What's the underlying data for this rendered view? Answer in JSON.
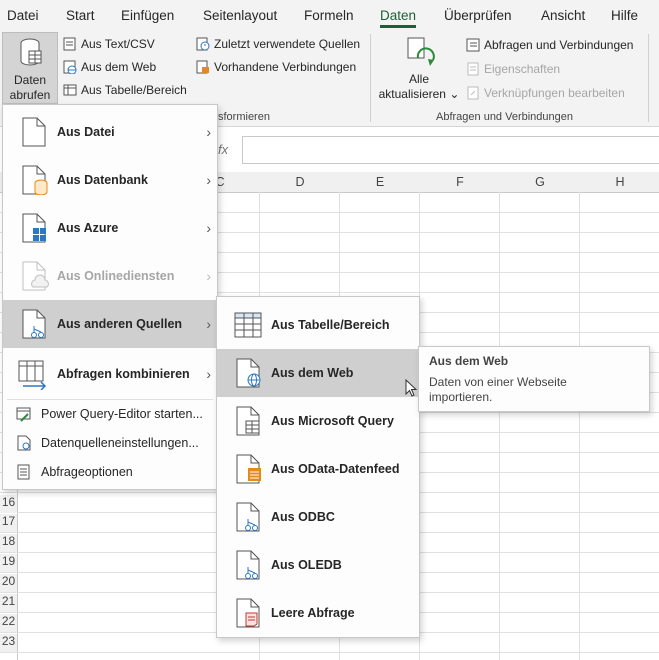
{
  "menubar": {
    "tabs": [
      "Datei",
      "Start",
      "Einfügen",
      "Seitenlayout",
      "Formeln",
      "Daten",
      "Überprüfen",
      "Ansicht",
      "Hilfe"
    ],
    "active": "Daten"
  },
  "ribbon": {
    "get_data": {
      "line1": "Daten",
      "line2": "abrufen ⌄"
    },
    "from_text": "Aus Text/CSV",
    "from_web": "Aus dem Web",
    "from_table": "Aus Tabelle/Bereich",
    "recent_sources": "Zuletzt verwendete Quellen",
    "existing_connections": "Vorhandene Verbindungen",
    "transform_group_label": "sformieren",
    "refresh_all": {
      "line1": "Alle",
      "line2": "aktualisieren ⌄"
    },
    "queries_connections": "Abfragen und Verbindungen",
    "properties": "Eigenschaften",
    "edit_links": "Verknüpfungen bearbeiten",
    "queries_group_label": "Abfragen und Verbindungen"
  },
  "formula_bar": {
    "fx": "fx"
  },
  "columns": [
    "C",
    "D",
    "E",
    "F",
    "G",
    "H"
  ],
  "rows": [
    "16",
    "17",
    "18",
    "19",
    "20",
    "21",
    "22",
    "23"
  ],
  "main_menu": {
    "items": [
      {
        "label": "Aus Datei",
        "icon": "file-icon",
        "submenu": true,
        "disabled": false
      },
      {
        "label": "Aus Datenbank",
        "icon": "database-file-icon",
        "submenu": true,
        "disabled": false
      },
      {
        "label": "Aus Azure",
        "icon": "azure-windows-icon",
        "submenu": true,
        "disabled": false
      },
      {
        "label": "Aus Onlinediensten",
        "icon": "cloud-file-icon",
        "submenu": true,
        "disabled": true
      },
      {
        "label": "Aus anderen Quellen",
        "icon": "other-sources-icon",
        "submenu": true,
        "disabled": false,
        "highlighted": true
      },
      {
        "label": "Abfragen kombinieren",
        "icon": "combine-queries-icon",
        "submenu": true,
        "disabled": false
      }
    ],
    "small_items": [
      {
        "label": "Power Query-Editor starten...",
        "icon": "power-query-icon"
      },
      {
        "label": "Datenquelleneinstellungen...",
        "icon": "data-source-settings-icon"
      },
      {
        "label": "Abfrageoptionen",
        "icon": "query-options-icon"
      }
    ]
  },
  "sub_menu": {
    "items": [
      {
        "label": "Aus Tabelle/Bereich",
        "icon": "table-icon"
      },
      {
        "label": "Aus dem Web",
        "icon": "web-globe-icon",
        "highlighted": true
      },
      {
        "label": "Aus Microsoft Query",
        "icon": "ms-query-icon"
      },
      {
        "label": "Aus OData-Datenfeed",
        "icon": "odata-icon"
      },
      {
        "label": "Aus ODBC",
        "icon": "odbc-icon"
      },
      {
        "label": "Aus OLEDB",
        "icon": "oledb-icon"
      },
      {
        "label": "Leere Abfrage",
        "icon": "blank-query-icon"
      }
    ]
  },
  "tooltip": {
    "title": "Aus dem Web",
    "body": "Daten von einer Webseite importieren."
  },
  "colors": {
    "accent": "#1e5e3a",
    "highlight": "#cfcfcf",
    "blue": "#2b78c5",
    "orange": "#e38a1e"
  }
}
